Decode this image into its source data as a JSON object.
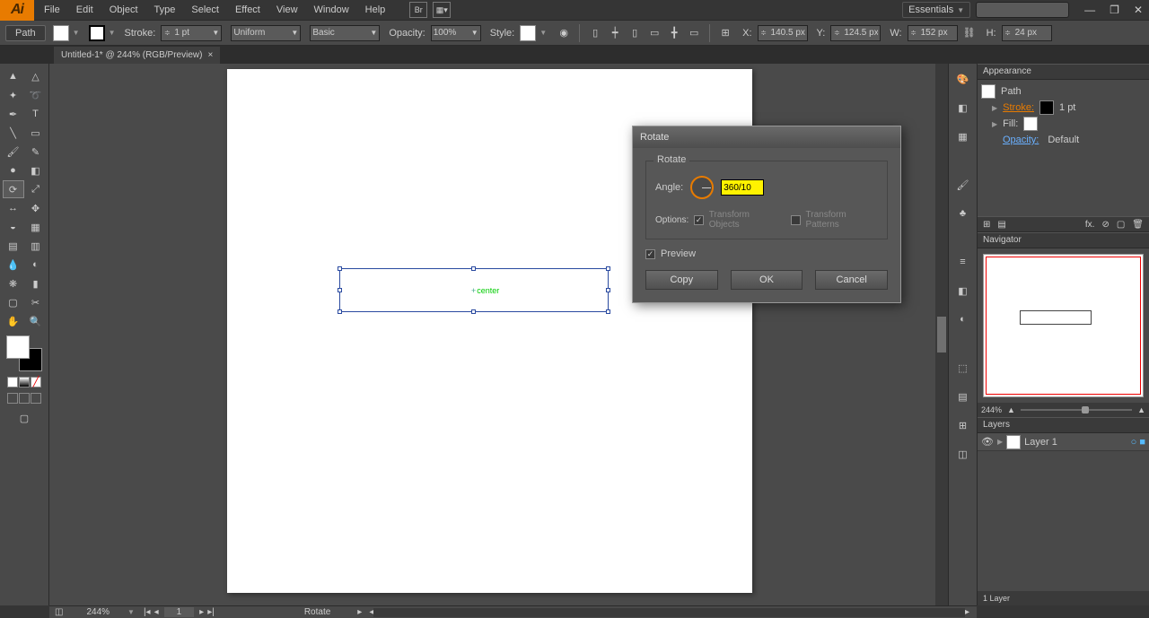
{
  "menu": {
    "items": [
      "File",
      "Edit",
      "Object",
      "Type",
      "Select",
      "Effect",
      "View",
      "Window",
      "Help"
    ],
    "workspace": "Essentials",
    "br": "Br"
  },
  "winctrl": {
    "min": "—",
    "max": "❐",
    "close": "✕"
  },
  "ctrl": {
    "selection_label": "Path",
    "stroke_label": "Stroke:",
    "stroke_weight": "1 pt",
    "brush_profile": "Uniform",
    "brush_def": "Basic",
    "opacity_label": "Opacity:",
    "opacity_val": "100%",
    "style_label": "Style:",
    "x_label": "X:",
    "x_val": "140.5 px",
    "y_label": "Y:",
    "y_val": "124.5 px",
    "w_label": "W:",
    "w_val": "152 px",
    "h_label": "H:",
    "h_val": "24 px"
  },
  "tab": {
    "title": "Untitled-1* @ 244% (RGB/Preview)",
    "close": "×"
  },
  "canvas": {
    "center_label": "center"
  },
  "dialog": {
    "title": "Rotate",
    "group_title": "Rotate",
    "angle_label": "Angle:",
    "angle_value": "360/10",
    "options_label": "Options:",
    "opt_objects": "Transform Objects",
    "opt_patterns": "Transform Patterns",
    "preview_label": "Preview",
    "btn_copy": "Copy",
    "btn_ok": "OK",
    "btn_cancel": "Cancel"
  },
  "appearance": {
    "title": "Appearance",
    "obj": "Path",
    "stroke": "Stroke:",
    "stroke_val": "1 pt",
    "fill": "Fill:",
    "opacity_label": "Opacity:",
    "opacity_val": "Default"
  },
  "navigator": {
    "title": "Navigator",
    "zoom": "244%"
  },
  "layers": {
    "title": "Layers",
    "name": "Layer 1",
    "footer": "1 Layer"
  },
  "status": {
    "zoom": "244%",
    "page": "1",
    "tool": "Rotate"
  }
}
